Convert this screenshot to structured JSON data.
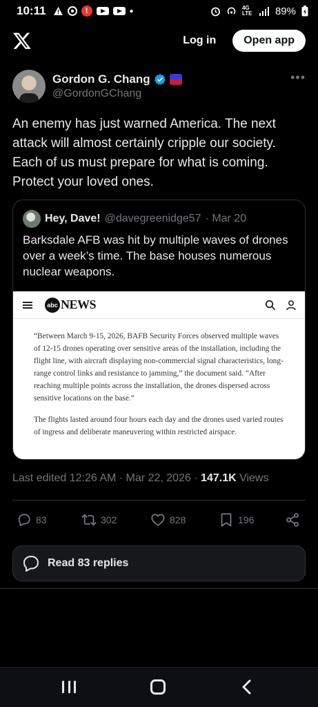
{
  "status_bar": {
    "time": "10:11",
    "network": "4G LTE",
    "battery": "89%"
  },
  "topnav": {
    "login_label": "Log in",
    "open_app_label": "Open app"
  },
  "tweet": {
    "author_name": "Gordon G. Chang",
    "author_handle": "@GordonGChang",
    "text": "An enemy has just warned America. The next attack will almost certainly cripple our society. Each of us must prepare for what is coming. Protect your loved ones.",
    "edited_label": "Last edited 12:26 AM · Mar 22, 2026 · ",
    "views_count": "147.1K",
    "views_label": " Views"
  },
  "quote": {
    "author_name": "Hey, Dave!",
    "author_handle": "@davegreenidge57",
    "date": "· Mar 20",
    "text": "Barksdale AFB was hit by multiple waves of drones over a week’s time. The base houses numerous nuclear weapons.",
    "embed": {
      "logo_text": "abc",
      "brand": "NEWS",
      "paragraph_1": "“Between March 9-15, 2026, BAFB Security Forces observed multiple waves of 12-15 drones operating over sensitive areas of the installation, including the flight line, with aircraft displaying non-commercial signal characteristics, long-range control links and resistance to jamming,” the document said. “After reaching multiple points across the installation, the drones dispersed across sensitive locations on the base.”",
      "paragraph_2": "The flights lasted around four hours each day and the drones used varied routes of ingress and deliberate maneuvering within restricted airspace."
    }
  },
  "actions": {
    "replies": "83",
    "reposts": "302",
    "likes": "828",
    "bookmarks": "196"
  },
  "read_replies_label": "Read 83 replies",
  "colors": {
    "background": "#000000",
    "verified": "#1d9bf0",
    "muted": "#71767b"
  }
}
